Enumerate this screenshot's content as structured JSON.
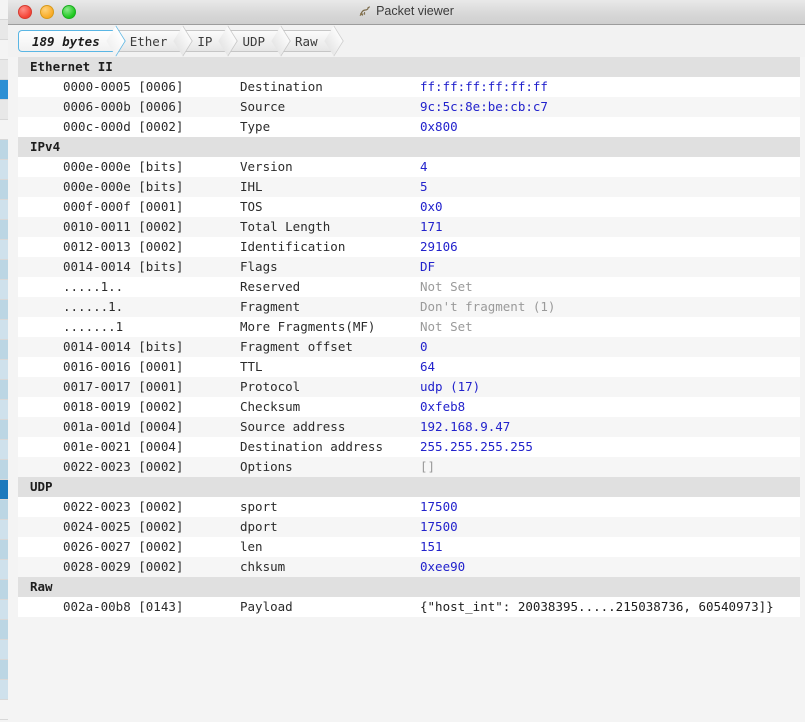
{
  "window": {
    "title": "Packet viewer",
    "app_icon": "scorpion-icon",
    "controls": {
      "close": "close",
      "minimize": "minimize",
      "maximize": "maximize"
    }
  },
  "breadcrumb": {
    "items": [
      {
        "label": "189 bytes",
        "active": true
      },
      {
        "label": "Ether",
        "active": false
      },
      {
        "label": "IP",
        "active": false
      },
      {
        "label": "UDP",
        "active": false
      },
      {
        "label": "Raw",
        "active": false
      }
    ]
  },
  "colors": {
    "value_blue": "#2222cc",
    "value_muted": "#9a9a9a",
    "section_bg": "#e0e0e0",
    "row_bg": "#ffffff",
    "row_alt_bg": "#f6f6f6",
    "accent_tab_border": "#5ab6e4"
  },
  "table": {
    "rows": [
      {
        "kind": "section",
        "label": "Ethernet II"
      },
      {
        "kind": "field",
        "offset": "0000-0005 [0006]",
        "name": "Destination",
        "value": "ff:ff:ff:ff:ff:ff",
        "style": "blue"
      },
      {
        "kind": "field",
        "offset": "0006-000b [0006]",
        "name": "Source",
        "value": "9c:5c:8e:be:cb:c7",
        "style": "blue"
      },
      {
        "kind": "field",
        "offset": "000c-000d [0002]",
        "name": "Type",
        "value": "0x800",
        "style": "blue"
      },
      {
        "kind": "section",
        "label": "IPv4"
      },
      {
        "kind": "field",
        "offset": "000e-000e [bits]",
        "name": "Version",
        "value": "4",
        "style": "blue"
      },
      {
        "kind": "field",
        "offset": "000e-000e [bits]",
        "name": "IHL",
        "value": "5",
        "style": "blue"
      },
      {
        "kind": "field",
        "offset": "000f-000f [0001]",
        "name": "TOS",
        "value": "0x0",
        "style": "blue"
      },
      {
        "kind": "field",
        "offset": "0010-0011 [0002]",
        "name": "Total Length",
        "value": "171",
        "style": "blue"
      },
      {
        "kind": "field",
        "offset": "0012-0013 [0002]",
        "name": "Identification",
        "value": "29106",
        "style": "blue"
      },
      {
        "kind": "field",
        "offset": "0014-0014 [bits]",
        "name": "Flags",
        "value": "DF",
        "style": "blue"
      },
      {
        "kind": "field",
        "offset": ".....1..",
        "name": "Reserved",
        "value": "Not Set",
        "style": "muted"
      },
      {
        "kind": "field",
        "offset": "......1.",
        "name": "Fragment",
        "value": "Don't fragment (1)",
        "style": "muted"
      },
      {
        "kind": "field",
        "offset": ".......1",
        "name": "More Fragments(MF)",
        "value": "Not Set",
        "style": "muted"
      },
      {
        "kind": "field",
        "offset": "0014-0014 [bits]",
        "name": "Fragment offset",
        "value": "0",
        "style": "blue"
      },
      {
        "kind": "field",
        "offset": "0016-0016 [0001]",
        "name": "TTL",
        "value": "64",
        "style": "blue"
      },
      {
        "kind": "field",
        "offset": "0017-0017 [0001]",
        "name": "Protocol",
        "value": "udp (17)",
        "style": "blue"
      },
      {
        "kind": "field",
        "offset": "0018-0019 [0002]",
        "name": "Checksum",
        "value": "0xfeb8",
        "style": "blue"
      },
      {
        "kind": "field",
        "offset": "001a-001d [0004]",
        "name": "Source address",
        "value": "192.168.9.47",
        "style": "blue"
      },
      {
        "kind": "field",
        "offset": "001e-0021 [0004]",
        "name": "Destination address",
        "value": "255.255.255.255",
        "style": "blue"
      },
      {
        "kind": "field",
        "offset": "0022-0023 [0002]",
        "name": "Options",
        "value": "[]",
        "style": "muted"
      },
      {
        "kind": "section",
        "label": "UDP"
      },
      {
        "kind": "field",
        "offset": "0022-0023 [0002]",
        "name": "sport",
        "value": "17500",
        "style": "blue"
      },
      {
        "kind": "field",
        "offset": "0024-0025 [0002]",
        "name": "dport",
        "value": "17500",
        "style": "blue"
      },
      {
        "kind": "field",
        "offset": "0026-0027 [0002]",
        "name": "len",
        "value": "151",
        "style": "blue"
      },
      {
        "kind": "field",
        "offset": "0028-0029 [0002]",
        "name": "chksum",
        "value": "0xee90",
        "style": "blue"
      },
      {
        "kind": "section",
        "label": "Raw"
      },
      {
        "kind": "field",
        "offset": "002a-00b8 [0143]",
        "name": "Payload",
        "value": "{\"host_int\": 20038395.....215038736, 60540973]}",
        "style": "plain"
      }
    ]
  }
}
